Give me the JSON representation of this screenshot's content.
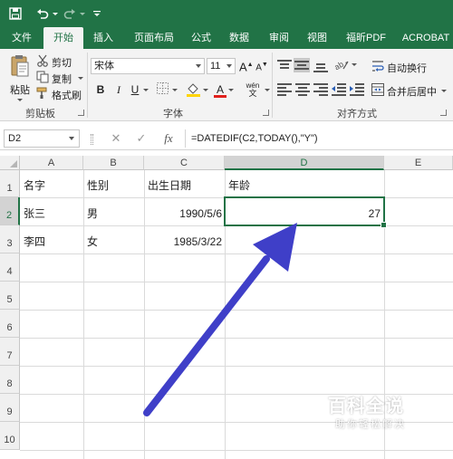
{
  "ribbon_tabs": [
    {
      "label": "文件",
      "active": false
    },
    {
      "label": "开始",
      "active": true
    },
    {
      "label": "插入",
      "active": false
    },
    {
      "label": "页面布局",
      "active": false
    },
    {
      "label": "公式",
      "active": false
    },
    {
      "label": "数据",
      "active": false
    },
    {
      "label": "审阅",
      "active": false
    },
    {
      "label": "视图",
      "active": false
    },
    {
      "label": "福昕PDF",
      "active": false
    },
    {
      "label": "ACROBAT",
      "active": false
    }
  ],
  "clipboard": {
    "paste_label": "粘贴",
    "cut_label": "剪切",
    "copy_label": "复制",
    "format_painter_label": "格式刷",
    "group_label": "剪贴板"
  },
  "font": {
    "font_name": "宋体",
    "font_size": "11",
    "group_label": "字体",
    "bold": "B",
    "italic": "I",
    "underline": "U",
    "grow_font": "A",
    "shrink_font": "A",
    "font_color_glyph": "A",
    "phonetic_glyph": "wén",
    "phonetic_glyph_top": "文"
  },
  "alignment": {
    "wrap_text_label": "自动换行",
    "merge_center_label": "合并后居中",
    "group_label": "对齐方式"
  },
  "formula_bar": {
    "name_box": "D2",
    "fx_label": "fx",
    "formula": "=DATEDIF(C2,TODAY(),\"Y\")"
  },
  "grid": {
    "columns": [
      "A",
      "B",
      "C",
      "D",
      "E"
    ],
    "selected_column": "D",
    "rows": [
      "1",
      "2",
      "3",
      "4",
      "5",
      "6",
      "7",
      "8",
      "9",
      "10"
    ],
    "selected_row": "2",
    "cells": {
      "A1": "名字",
      "B1": "性别",
      "C1": "出生日期",
      "D1": "年龄",
      "A2": "张三",
      "B2": "男",
      "C2": "1990/5/6",
      "D2": "27",
      "A3": "李四",
      "B3": "女",
      "C3": "1985/3/22"
    },
    "active_cell": "D2"
  },
  "annotation": {
    "arrow_color": "#3f3fc8"
  },
  "watermark": {
    "title": "百科全说",
    "subtitle": "助你轻松解决"
  },
  "colors": {
    "excel_green": "#217346",
    "ribbon_bg": "#f3f3f3"
  }
}
